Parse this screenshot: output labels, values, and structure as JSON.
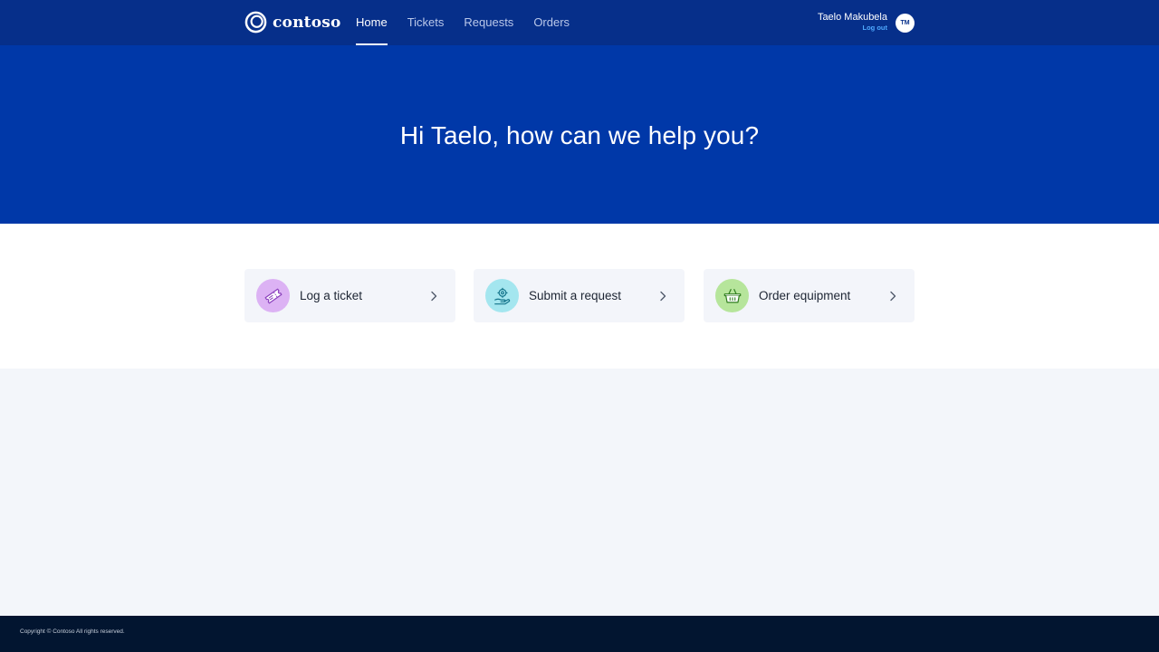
{
  "header": {
    "brand": "contoso",
    "nav": [
      {
        "label": "Home",
        "active": true
      },
      {
        "label": "Tickets",
        "active": false
      },
      {
        "label": "Requests",
        "active": false
      },
      {
        "label": "Orders",
        "active": false
      }
    ],
    "user": {
      "name": "Taelo Makubela",
      "logout_label": "Log out",
      "initials": "TM"
    }
  },
  "hero": {
    "title": "Hi Taelo, how can we help you?"
  },
  "actions": [
    {
      "label": "Log a ticket",
      "icon": "ticket-icon",
      "icon_bg": "#dcb2f4"
    },
    {
      "label": "Submit a request",
      "icon": "hand-gear-icon",
      "icon_bg": "#a4e6ef"
    },
    {
      "label": "Order equipment",
      "icon": "basket-icon",
      "icon_bg": "#b6e59b"
    }
  ],
  "footer": {
    "copyright": "Copyright © Contoso All rights reserved."
  },
  "colors": {
    "topnav": "#062f8a",
    "hero": "#0038a8",
    "accent_link": "#4fa9ff",
    "footer": "#021530",
    "page_bg": "#f3f6fa"
  }
}
